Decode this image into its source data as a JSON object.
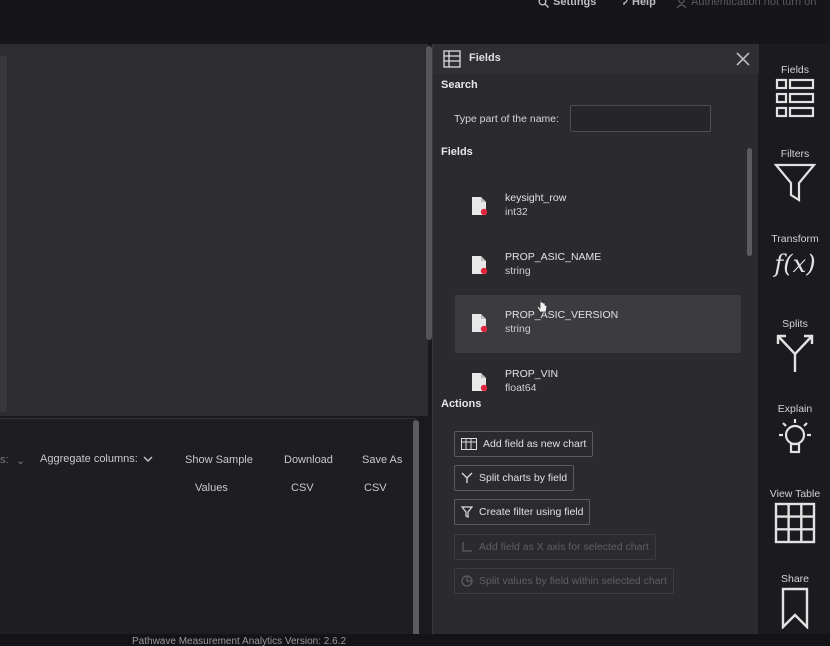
{
  "topbar": {
    "settings": "Settings",
    "help": "Help",
    "auth": "Authentication not turn on"
  },
  "table_toolbar": {
    "cutoff_label": "s:",
    "aggregate": "Aggregate columns:",
    "show_sample": "Show Sample",
    "values": "Values",
    "download": "Download",
    "download_csv": "CSV",
    "save_as": "Save As",
    "save_csv": "CSV"
  },
  "footer": {
    "version": "Pathwave Measurement Analytics Version: 2.6.2"
  },
  "panel": {
    "title": "Fields",
    "search_section": "Search",
    "search_label": "Type part of the name:",
    "search_value": "",
    "fields_section": "Fields",
    "fields": [
      {
        "name": "keysight_row",
        "type": "int32"
      },
      {
        "name": "PROP_ASIC_NAME",
        "type": "string"
      },
      {
        "name": "PROP_ASIC_VERSION",
        "type": "string"
      },
      {
        "name": "PROP_VIN",
        "type": "float64"
      }
    ],
    "actions_section": "Actions",
    "actions": [
      {
        "label": "Add field as new chart",
        "enabled": true
      },
      {
        "label": "Split charts by field",
        "enabled": true
      },
      {
        "label": "Create filter using field",
        "enabled": true
      },
      {
        "label": "Add field as X axis for selected chart",
        "enabled": false
      },
      {
        "label": "Split values by field within selected chart",
        "enabled": false
      }
    ]
  },
  "rail": [
    {
      "label": "Fields",
      "icon": "fields-list-icon"
    },
    {
      "label": "Filters",
      "icon": "funnel-icon"
    },
    {
      "label": "Transform",
      "icon": "function-icon"
    },
    {
      "label": "Splits",
      "icon": "split-icon"
    },
    {
      "label": "Explain",
      "icon": "lightbulb-icon"
    },
    {
      "label": "View Table",
      "icon": "grid-icon"
    },
    {
      "label": "Share",
      "icon": "bookmark-icon"
    }
  ],
  "colors": {
    "background": "#1a1a1e",
    "panel": "#2b2b2f",
    "canvas": "#2d2d31",
    "field_badge": "#e0243a"
  }
}
